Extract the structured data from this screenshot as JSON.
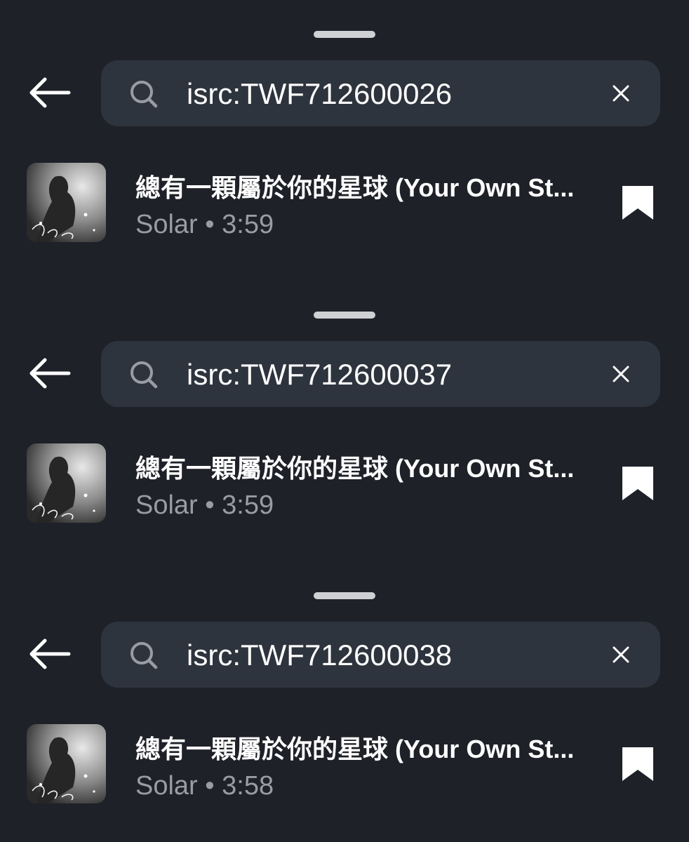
{
  "colors": {
    "background": "#1f2128",
    "search_field": "#2e343d",
    "primary_text": "#ffffff",
    "secondary_text": "#9a9ca3",
    "handle": "#cfd0d4"
  },
  "icons": {
    "back": "back-arrow-icon",
    "search": "search-icon",
    "clear": "close-icon",
    "bookmark": "bookmark-icon"
  },
  "panels": [
    {
      "search": {
        "query": "isrc:TWF712600026"
      },
      "result": {
        "title": "總有一顆屬於你的星球 (Your Own St...",
        "artist": "Solar",
        "separator": "•",
        "duration": "3:59"
      }
    },
    {
      "search": {
        "query": "isrc:TWF712600037"
      },
      "result": {
        "title": "總有一顆屬於你的星球 (Your Own St...",
        "artist": "Solar",
        "separator": "•",
        "duration": "3:59"
      }
    },
    {
      "search": {
        "query": "isrc:TWF712600038"
      },
      "result": {
        "title": "總有一顆屬於你的星球 (Your Own St...",
        "artist": "Solar",
        "separator": "•",
        "duration": "3:58"
      }
    }
  ]
}
